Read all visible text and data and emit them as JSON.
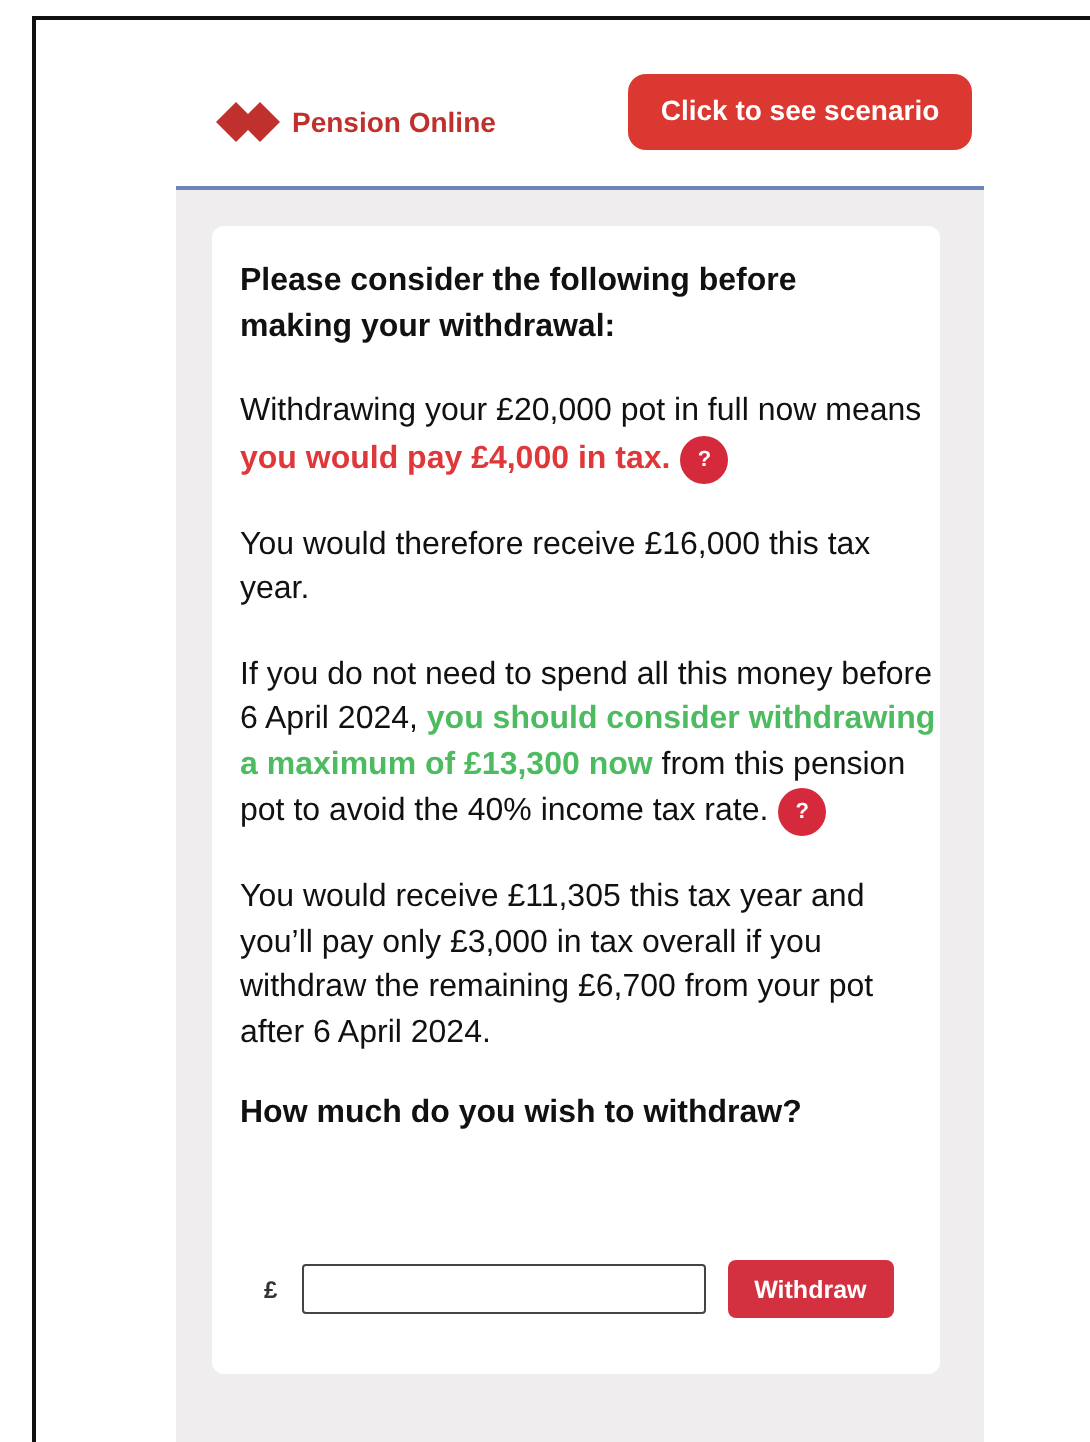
{
  "header": {
    "brand": "Pension Online",
    "scenario_button": "Click to see scenario"
  },
  "card": {
    "heading": "Please consider the following before making your withdrawal:",
    "paragraphs": [
      {
        "segments": [
          {
            "text": "Withdrawing your £20,000 pot in full now means ",
            "kind": "plain"
          },
          {
            "text": "you would pay £4,000 in tax.",
            "kind": "warning"
          }
        ],
        "help": "?"
      },
      {
        "segments": [
          {
            "text": "You would therefore receive £16,000 this tax year.",
            "kind": "plain"
          }
        ]
      },
      {
        "segments": [
          {
            "text": "If you do not need to spend all this money before 6 April 2024, ",
            "kind": "plain"
          },
          {
            "text": "you should consider withdrawing a maximum of £13,300 now",
            "kind": "advice"
          },
          {
            "text": " from this pension pot to avoid the 40% income tax rate.",
            "kind": "plain"
          }
        ],
        "help": "?"
      },
      {
        "segments": [
          {
            "text": "You would receive £11,305 this tax year and you’ll pay only £3,000 in tax overall if you withdraw the remaining £6,700 from your pot after 6 April 2024.",
            "kind": "plain"
          }
        ]
      }
    ],
    "question": "How much do you wish to withdraw?",
    "currency": "£",
    "withdraw_button": "Withdraw"
  }
}
